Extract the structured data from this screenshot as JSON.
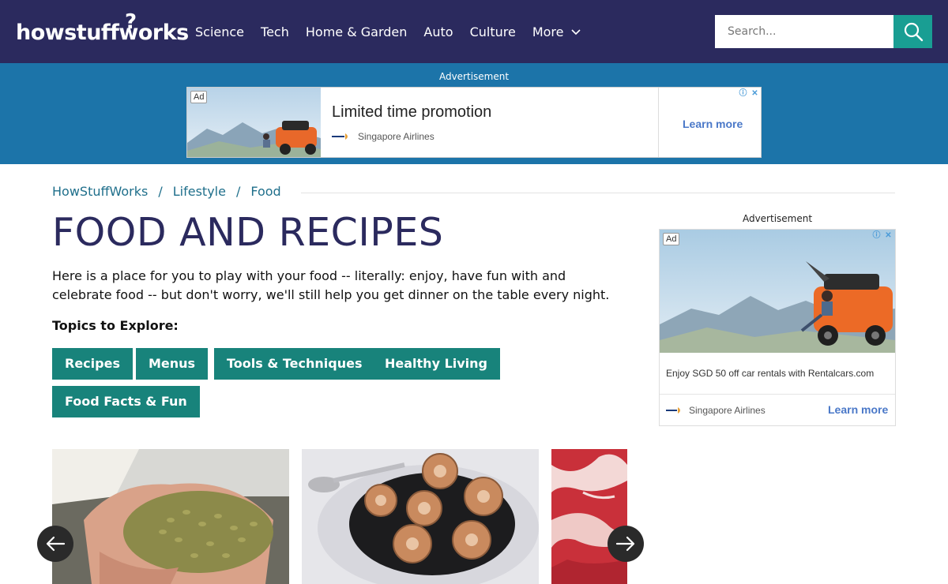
{
  "header": {
    "logo_text": "howstuffworks",
    "nav": [
      "Science",
      "Tech",
      "Home & Garden",
      "Auto",
      "Culture"
    ],
    "more_label": "More",
    "search_placeholder": "Search...",
    "colors": {
      "bg": "#2b2a5e",
      "search_button": "#199e93"
    }
  },
  "top_ad": {
    "label": "Advertisement",
    "badge": "Ad",
    "title": "Limited time promotion",
    "brand": "Singapore Airlines",
    "cta": "Learn more",
    "band_color": "#1c74a9"
  },
  "breadcrumb": [
    "HowStuffWorks",
    "Lifestyle",
    "Food"
  ],
  "breadcrumb_separator": "/",
  "page": {
    "title": "FOOD AND RECIPES",
    "intro": "Here is a place for you to play with your food -- literally: enjoy, have fun with and celebrate food -- but don't worry, we'll still help you get dinner on the table every night.",
    "topics_label": "Topics to Explore:"
  },
  "topics": [
    "Recipes",
    "Menus",
    "Tools & Techniques",
    "Healthy Living",
    "Food Facts & Fun"
  ],
  "topic_color": "#18837b",
  "carousel": {
    "cards": [
      "coffee-beans-photo",
      "escargot-photo",
      "cured-ham-photo"
    ],
    "prev_icon": "arrow-left-icon",
    "next_icon": "arrow-right-icon"
  },
  "side_ad": {
    "label": "Advertisement",
    "badge": "Ad",
    "text": "Enjoy SGD 50 off car rentals with Rentalcars.com",
    "brand": "Singapore Airlines",
    "cta": "Learn more"
  }
}
